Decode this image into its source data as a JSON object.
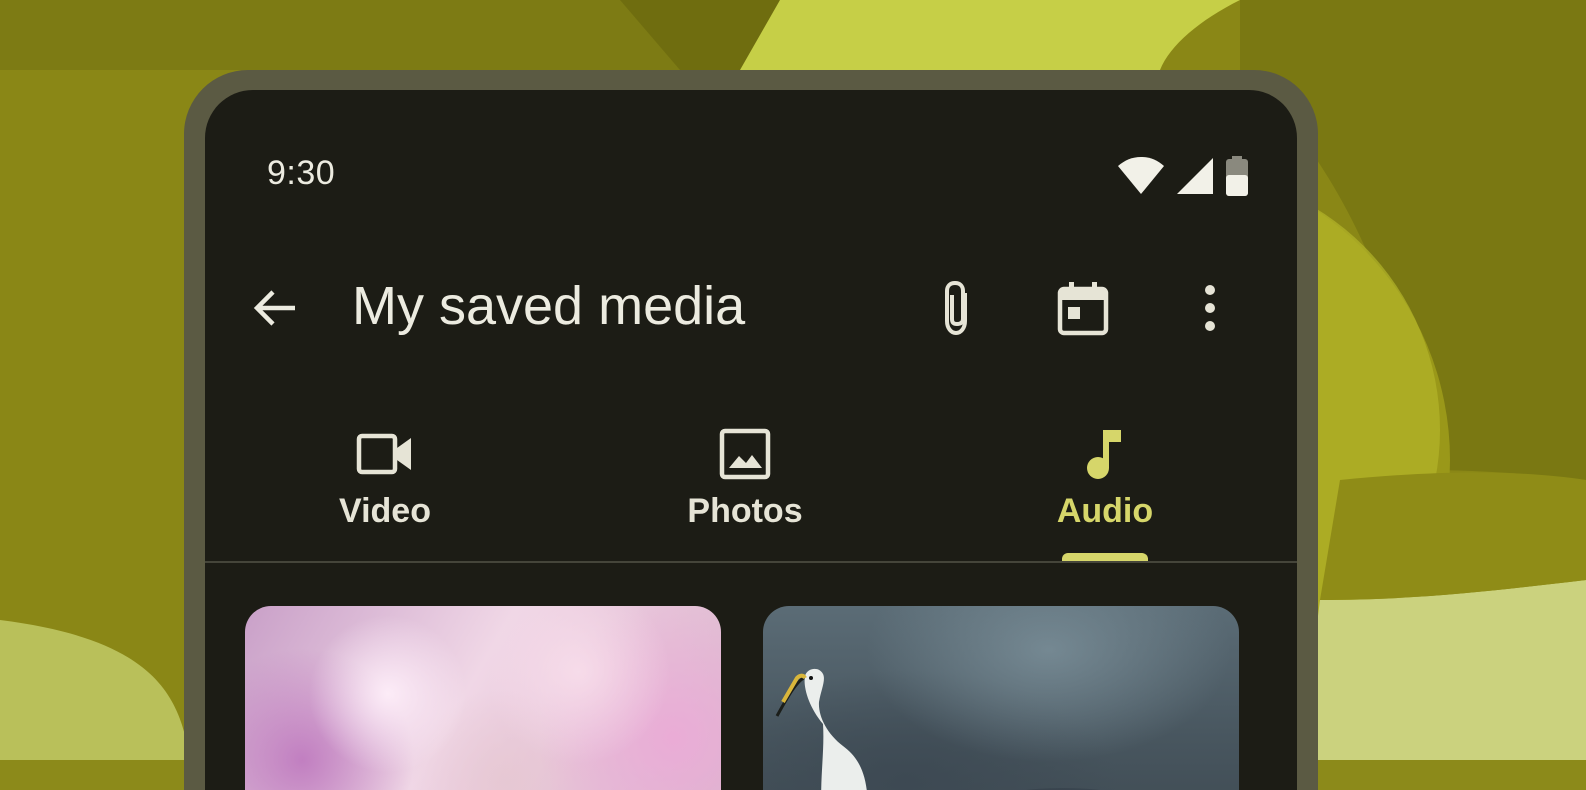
{
  "status_bar": {
    "time": "9:30",
    "icons": [
      "wifi-icon",
      "signal-icon",
      "battery-icon"
    ]
  },
  "top_app_bar": {
    "title": "My saved media",
    "navigation_icon": "back-arrow-icon",
    "actions": [
      "attachment-icon",
      "calendar-icon",
      "more-vert-icon"
    ]
  },
  "tabs": [
    {
      "label": "Video",
      "icon": "videocam-icon",
      "selected": false
    },
    {
      "label": "Photos",
      "icon": "image-icon",
      "selected": false
    },
    {
      "label": "Audio",
      "icon": "music-note-icon",
      "selected": true
    }
  ],
  "media_grid": {
    "items": [
      {
        "kind": "image",
        "subject": "pink flowers bokeh"
      },
      {
        "kind": "image",
        "subject": "white egret near water"
      }
    ]
  },
  "colors": {
    "background_olive": "#8c8a1a",
    "frame": "#5b5a43",
    "surface": "#1c1c15",
    "on_surface": "#e6e4d6",
    "primary_accent": "#d6d66a",
    "divider": "#45453a"
  }
}
